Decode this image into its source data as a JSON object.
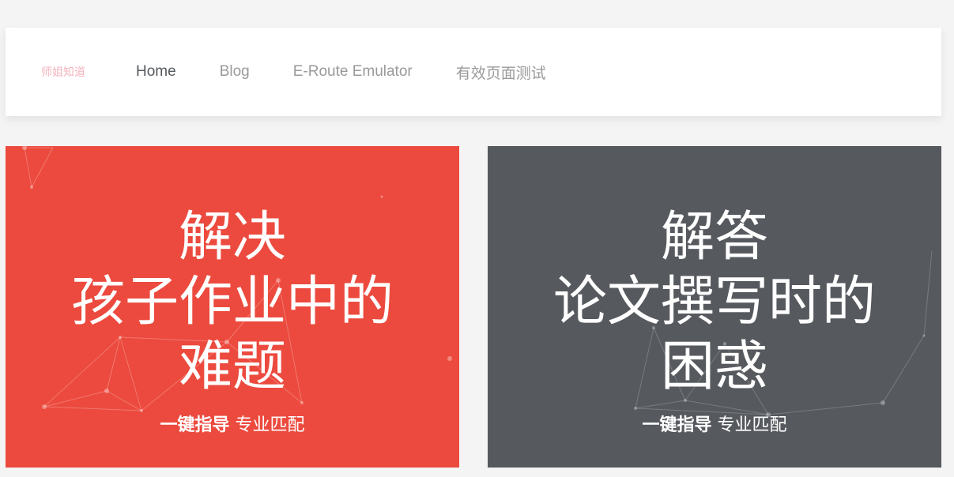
{
  "nav": {
    "brand": "师姐知道",
    "links": [
      {
        "label": "Home"
      },
      {
        "label": "Blog"
      },
      {
        "label": "E-Route Emulator"
      },
      {
        "label": "有效页面测试"
      }
    ]
  },
  "cards": [
    {
      "headline": [
        "解决",
        "孩子作业中的",
        "难题"
      ],
      "tagline_bold": "一键指导",
      "tagline_rest": "专业匹配",
      "color": "#ec4a3e"
    },
    {
      "headline": [
        "解答",
        "论文撰写时的",
        "困惑"
      ],
      "tagline_bold": "一键指导",
      "tagline_rest": "专业匹配",
      "color": "#56595e"
    }
  ],
  "colors": {
    "page_bg": "#f4f4f4",
    "brand_pink": "#f3b3bd",
    "nav_active": "#555a5e",
    "nav_inactive": "#9a9a9a"
  }
}
